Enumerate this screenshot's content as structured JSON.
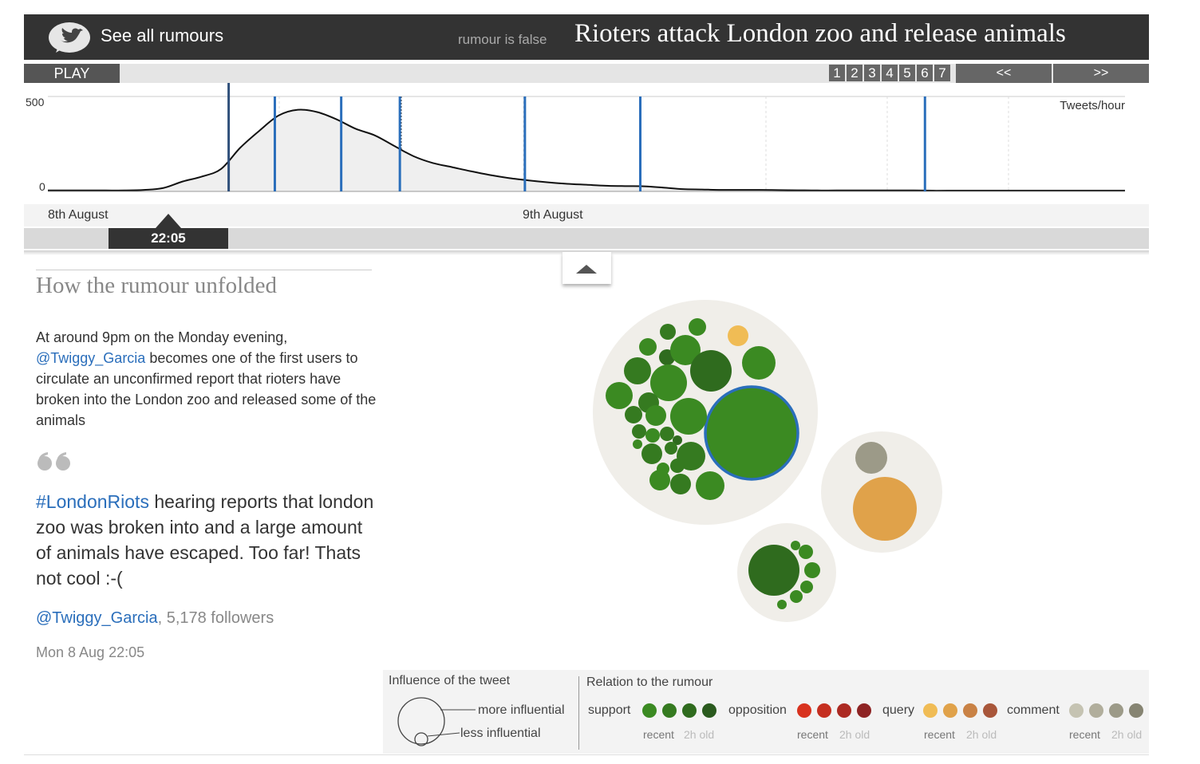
{
  "header": {
    "see_all_label": "See all rumours",
    "status_label": "rumour is false",
    "headline": "Rioters attack London zoo and release animals"
  },
  "controls": {
    "play_label": "PLAY",
    "steps": [
      "1",
      "2",
      "3",
      "4",
      "5",
      "6",
      "7"
    ],
    "prev_label": "<<",
    "next_label": ">>"
  },
  "timeline": {
    "y_max_label": "500",
    "y_min_label": "0",
    "unit_label": "Tweets/hour",
    "date_labels": [
      "8th August",
      "9th August"
    ],
    "current_time": "22:05"
  },
  "chart_data": {
    "type": "area",
    "ylim": [
      0,
      500
    ],
    "ylabel": "Tweets/hour",
    "x_labels": [
      "8th August",
      "9th August"
    ],
    "x_hours": [
      0,
      2,
      4,
      6,
      8,
      10,
      12,
      14,
      16,
      18,
      20,
      22,
      24,
      26,
      28,
      30,
      32,
      34,
      36,
      38,
      40,
      42,
      44,
      46,
      48,
      50,
      52,
      54,
      56,
      58,
      60,
      62,
      64,
      66,
      68,
      70,
      72,
      74,
      76,
      78,
      80,
      82,
      84,
      86,
      88,
      90,
      92,
      94,
      96,
      98,
      100,
      102,
      104,
      106,
      108,
      110,
      112
    ],
    "values": [
      5,
      5,
      5,
      5,
      5,
      8,
      18,
      52,
      78,
      118,
      230,
      320,
      400,
      430,
      418,
      380,
      330,
      295,
      240,
      186,
      150,
      128,
      106,
      86,
      70,
      58,
      48,
      40,
      35,
      30,
      28,
      27,
      20,
      12,
      10,
      8,
      8,
      8,
      7,
      6,
      5,
      5,
      5,
      5,
      5,
      5,
      4,
      4,
      4,
      4,
      4,
      4,
      4,
      4,
      4,
      4,
      4
    ],
    "event_hours": [
      18.8,
      23.6,
      30.5,
      36.6,
      49.6,
      61.6,
      91.2
    ],
    "current_hour": 18.8
  },
  "story": {
    "section_title": "How the rumour unfolded",
    "intro_before": "At around 9pm on the Monday evening,",
    "intro_link": "@Twiggy_Garcia",
    "intro_after": " becomes one of the first users to circulate an unconfirmed report that rioters have broken into the London zoo and released some of the animals",
    "tweet_hashtag": "#LondonRiots",
    "tweet_text": " hearing reports that london zoo was broken into and a large amount of animals have escaped. Too far! Thats not cool :-(",
    "author": "@Twiggy_Garcia",
    "followers": ", 5,178 followers",
    "timestamp": "Mon 8 Aug 22:05"
  },
  "legend": {
    "influence_title": "Influence of the tweet",
    "more_label": "more influential",
    "less_label": "less influential",
    "relation_title": "Relation to the rumour",
    "recent_label": "recent",
    "old_label": "2h old",
    "categories": [
      {
        "label": "support",
        "colors": [
          "#3b8a22",
          "#357a20",
          "#2f6b1e",
          "#2a5a1e"
        ]
      },
      {
        "label": "opposition",
        "colors": [
          "#d8321e",
          "#c52f20",
          "#ac2a22",
          "#8e2424"
        ]
      },
      {
        "label": "query",
        "colors": [
          "#f0bc55",
          "#e0a24a",
          "#c98245",
          "#a8563a"
        ]
      },
      {
        "label": "comment",
        "colors": [
          "#c5c3b2",
          "#b1ae9c",
          "#9c9a88",
          "#868472"
        ]
      }
    ]
  },
  "colors": {
    "bar": "#333333",
    "accent_blue": "#2a6ebb",
    "support": "#3b8a22"
  }
}
